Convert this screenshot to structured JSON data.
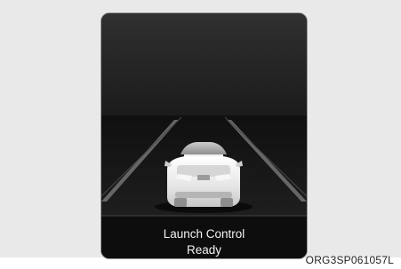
{
  "status": {
    "title": "Launch Control",
    "state": "Ready"
  },
  "figure_code": "ORG3SP061057L",
  "icons": {
    "vehicle": "rear-view-car-icon",
    "road": "lane-lines-icon"
  },
  "colors": {
    "background": "#e9e9e9",
    "screen": "#111111",
    "text": "#f2f2f2"
  }
}
